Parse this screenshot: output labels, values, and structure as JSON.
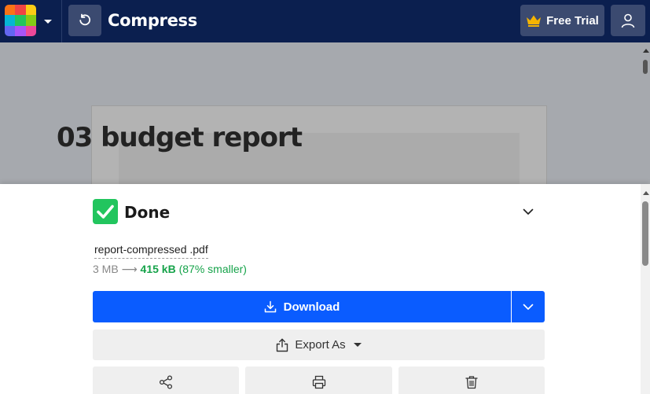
{
  "topbar": {
    "title": "Compress",
    "free_trial_label": "Free Trial",
    "logo_colors": [
      "#f97316",
      "#ef4444",
      "#facc15",
      "#06b6d4",
      "#22c55e",
      "#84cc16",
      "#6366f1",
      "#a855f7",
      "#ec4899"
    ],
    "icons": {
      "logo_menu": "chevron-down-icon",
      "back": "undo-icon",
      "crown": "crown-icon",
      "user": "user-icon"
    }
  },
  "background": {
    "heading": "03 budget report"
  },
  "panel": {
    "status": "Done",
    "filename": "report-compressed .pdf",
    "size": {
      "original": "3 MB",
      "arrow": "⟶",
      "compressed": "415 kB",
      "reduction": "(87% smaller)"
    },
    "download_label": "Download",
    "export_label": "Export As",
    "actions": [
      "share-icon",
      "print-icon",
      "trash-icon"
    ]
  },
  "colors": {
    "topbar": "#0b1f4f",
    "primary": "#0a5cff",
    "success": "#22c55e",
    "crown": "#f5b400"
  }
}
